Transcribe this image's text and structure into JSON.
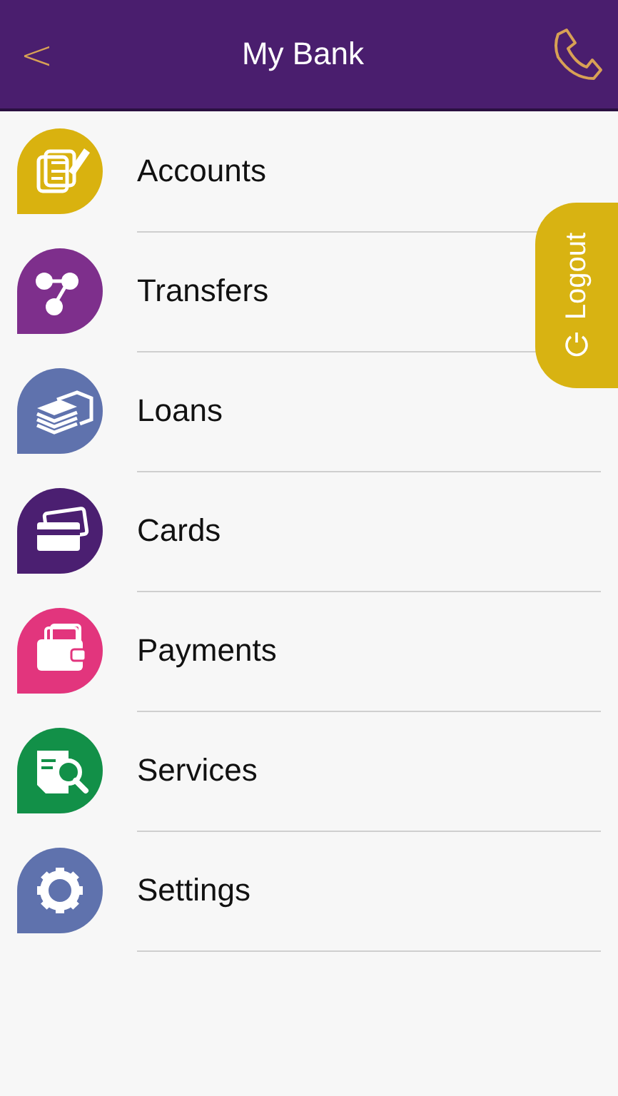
{
  "header": {
    "back": "<",
    "title": "My Bank"
  },
  "menu": [
    {
      "label": "Accounts",
      "color": "#d9b20f"
    },
    {
      "label": "Transfers",
      "color": "#7e2f8c"
    },
    {
      "label": "Loans",
      "color": "#5f72ad"
    },
    {
      "label": "Cards",
      "color": "#4b1f71"
    },
    {
      "label": "Payments",
      "color": "#e2357d"
    },
    {
      "label": "Services",
      "color": "#129048"
    },
    {
      "label": "Settings",
      "color": "#5f72ad"
    }
  ],
  "logout": {
    "label": "Logout"
  }
}
